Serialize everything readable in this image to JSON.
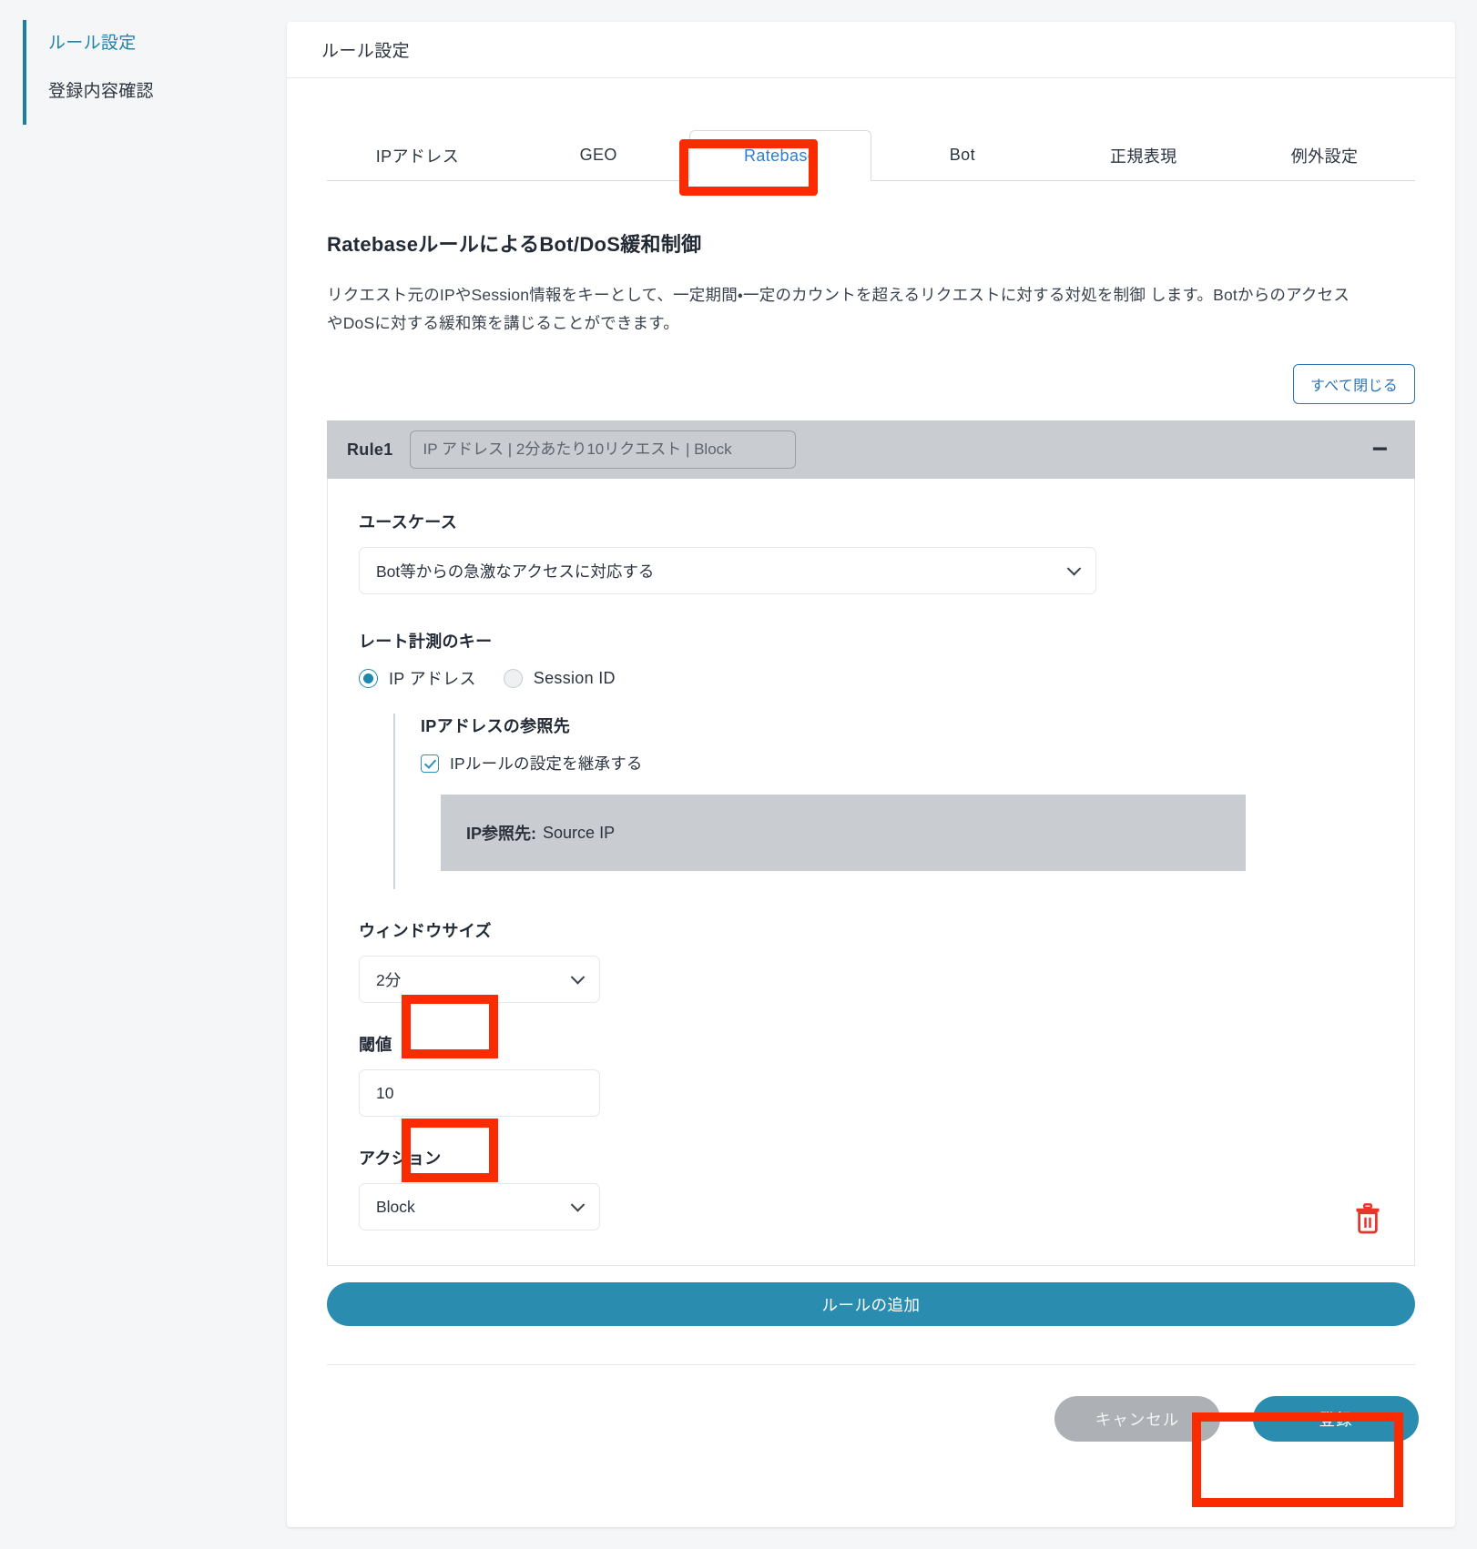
{
  "sidebar": {
    "items": [
      {
        "label": "ルール設定",
        "active": true
      },
      {
        "label": "登録内容確認",
        "active": false
      }
    ]
  },
  "card": {
    "header_title": "ルール設定"
  },
  "tabs": [
    {
      "label": "IPアドレス",
      "active": false
    },
    {
      "label": "GEO",
      "active": false
    },
    {
      "label": "Ratebase",
      "active": true
    },
    {
      "label": "Bot",
      "active": false
    },
    {
      "label": "正規表現",
      "active": false
    },
    {
      "label": "例外設定",
      "active": false
    }
  ],
  "section": {
    "title": "RatebaseルールによるBot/DoS緩和制御",
    "description": "リクエスト元のIPやSession情報をキーとして、一定期間・一定のカウントを超えるリクエストに対する対処を制御します。Botからのアクセスやr DoSに対する緩和策を講じることができます。",
    "description_line1": "リクエスト元のIPやSession情報をキーとして、一定期間・一定のカウントを超えるリクエストに対する対処を制御",
    "description_line2": "します。BotからのアクセスやDoSに対する緩和策を講じることができます。",
    "close_all_label": "すべて閉じる"
  },
  "rule": {
    "name": "Rule1",
    "summary_placeholder": "IP アドレス | 2分あたり10リクエスト | Block",
    "summary_value": "",
    "collapse_icon": "minus-icon",
    "usecase": {
      "label": "ユースケース",
      "value": "Bot等からの急激なアクセスに対応する"
    },
    "rate_key": {
      "label": "レート計測のキー",
      "options": [
        {
          "label": "IP アドレス",
          "selected": true
        },
        {
          "label": "Session ID",
          "selected": false
        }
      ]
    },
    "ip_reference": {
      "title": "IPアドレスの参照先",
      "inherit_checkbox_label": "IPルールの設定を継承する",
      "inherit_checked": true,
      "info_key": "IP参照先:",
      "info_value": "Source IP"
    },
    "window_size": {
      "label": "ウィンドウサイズ",
      "value": "2分"
    },
    "threshold": {
      "label": "閾値",
      "value": "10"
    },
    "action": {
      "label": "アクション",
      "value": "Block"
    },
    "delete_icon": "trash-icon"
  },
  "buttons": {
    "add_rule": "ルールの追加",
    "cancel": "キャンセル",
    "submit": "登録"
  },
  "colors": {
    "accent_teal": "#2a8cae",
    "link_blue": "#2b7fd4",
    "annotation_red": "#fb2b00",
    "rule_header_gray": "#c9ccd1",
    "cancel_gray": "#adb0b4"
  }
}
